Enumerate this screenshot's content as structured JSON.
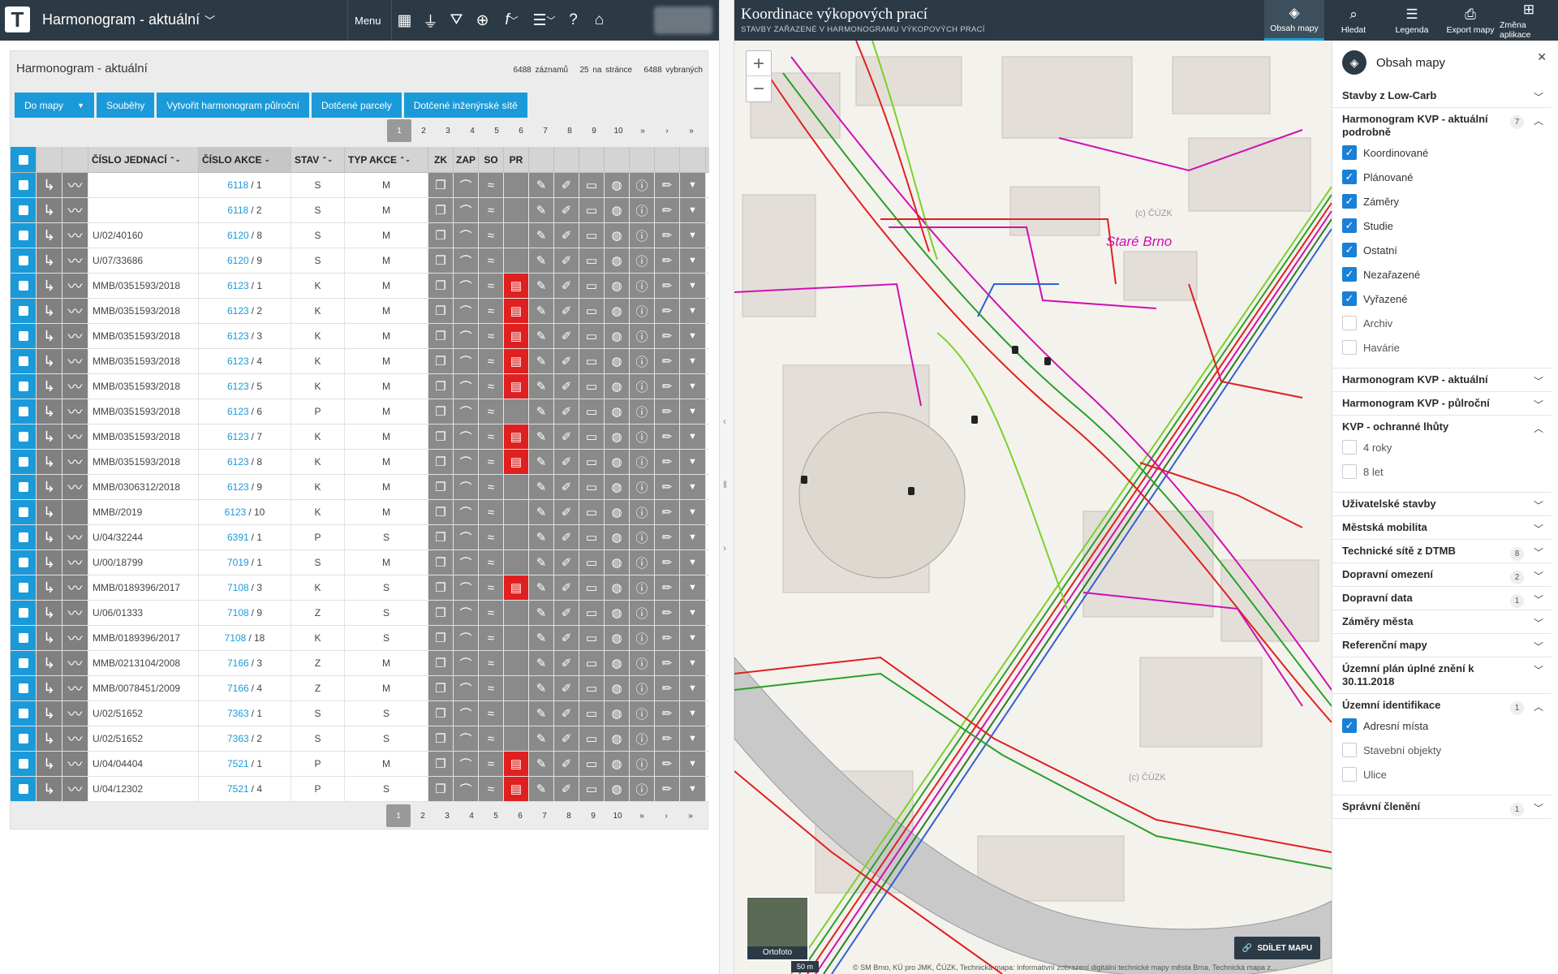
{
  "left": {
    "app_title": "Harmonogram - aktuální",
    "menu_label": "Menu",
    "panel_title": "Harmonogram - aktuální",
    "stats": {
      "records": "6488 záznamů",
      "per_page": "25 na stránce",
      "selected": "6488 vybraných"
    },
    "buttons": [
      "Do mapy",
      "Souběhy",
      "Vytvořit harmonogram půlroční",
      "Dotčené parcely",
      "Dotčené inženýrské sítě"
    ],
    "pagination": [
      "1",
      "2",
      "3",
      "4",
      "5",
      "6",
      "7",
      "8",
      "9",
      "10",
      "»",
      "›",
      "»"
    ],
    "columns": [
      "Číslo jednací",
      "Číslo akce",
      "Stav",
      "Typ akce",
      "ZK",
      "ZAP",
      "SO",
      "PR"
    ],
    "rows": [
      {
        "cj": "",
        "akce": "6118",
        "sub": "/ 1",
        "stav": "S",
        "typ": "M",
        "pr": false,
        "trend": true
      },
      {
        "cj": "",
        "akce": "6118",
        "sub": "/ 2",
        "stav": "S",
        "typ": "M",
        "pr": false,
        "trend": true
      },
      {
        "cj": "U/02/40160",
        "akce": "6120",
        "sub": "/ 8",
        "stav": "S",
        "typ": "M",
        "pr": false,
        "trend": true
      },
      {
        "cj": "U/07/33686",
        "akce": "6120",
        "sub": "/ 9",
        "stav": "S",
        "typ": "M",
        "pr": false,
        "trend": true
      },
      {
        "cj": "MMB/0351593/2018",
        "akce": "6123",
        "sub": "/ 1",
        "stav": "K",
        "typ": "M",
        "pr": true,
        "trend": true
      },
      {
        "cj": "MMB/0351593/2018",
        "akce": "6123",
        "sub": "/ 2",
        "stav": "K",
        "typ": "M",
        "pr": true,
        "trend": true
      },
      {
        "cj": "MMB/0351593/2018",
        "akce": "6123",
        "sub": "/ 3",
        "stav": "K",
        "typ": "M",
        "pr": true,
        "trend": true
      },
      {
        "cj": "MMB/0351593/2018",
        "akce": "6123",
        "sub": "/ 4",
        "stav": "K",
        "typ": "M",
        "pr": true,
        "trend": true
      },
      {
        "cj": "MMB/0351593/2018",
        "akce": "6123",
        "sub": "/ 5",
        "stav": "K",
        "typ": "M",
        "pr": true,
        "trend": true
      },
      {
        "cj": "MMB/0351593/2018",
        "akce": "6123",
        "sub": "/ 6",
        "stav": "P",
        "typ": "M",
        "pr": false,
        "trend": true
      },
      {
        "cj": "MMB/0351593/2018",
        "akce": "6123",
        "sub": "/ 7",
        "stav": "K",
        "typ": "M",
        "pr": true,
        "trend": true
      },
      {
        "cj": "MMB/0351593/2018",
        "akce": "6123",
        "sub": "/ 8",
        "stav": "K",
        "typ": "M",
        "pr": true,
        "trend": true
      },
      {
        "cj": "MMB/0306312/2018",
        "akce": "6123",
        "sub": "/ 9",
        "stav": "K",
        "typ": "M",
        "pr": false,
        "trend": true
      },
      {
        "cj": "MMB//2019",
        "akce": "6123",
        "sub": "/ 10",
        "stav": "K",
        "typ": "M",
        "pr": false,
        "trend": false
      },
      {
        "cj": "U/04/32244",
        "akce": "6391",
        "sub": "/ 1",
        "stav": "P",
        "typ": "S",
        "pr": false,
        "trend": true
      },
      {
        "cj": "U/00/18799",
        "akce": "7019",
        "sub": "/ 1",
        "stav": "S",
        "typ": "M",
        "pr": false,
        "trend": true
      },
      {
        "cj": "MMB/0189396/2017",
        "akce": "7108",
        "sub": "/ 3",
        "stav": "K",
        "typ": "S",
        "pr": true,
        "trend": true
      },
      {
        "cj": "U/06/01333",
        "akce": "7108",
        "sub": "/ 9",
        "stav": "Z",
        "typ": "S",
        "pr": false,
        "trend": true
      },
      {
        "cj": "MMB/0189396/2017",
        "akce": "7108",
        "sub": "/ 18",
        "stav": "K",
        "typ": "S",
        "pr": false,
        "trend": true
      },
      {
        "cj": "MMB/0213104/2008",
        "akce": "7166",
        "sub": "/ 3",
        "stav": "Z",
        "typ": "M",
        "pr": false,
        "trend": true
      },
      {
        "cj": "MMB/0078451/2009",
        "akce": "7166",
        "sub": "/ 4",
        "stav": "Z",
        "typ": "M",
        "pr": false,
        "trend": true
      },
      {
        "cj": "U/02/51652",
        "akce": "7363",
        "sub": "/ 1",
        "stav": "S",
        "typ": "S",
        "pr": false,
        "trend": true
      },
      {
        "cj": "U/02/51652",
        "akce": "7363",
        "sub": "/ 2",
        "stav": "S",
        "typ": "S",
        "pr": false,
        "trend": true
      },
      {
        "cj": "U/04/04404",
        "akce": "7521",
        "sub": "/ 1",
        "stav": "P",
        "typ": "M",
        "pr": true,
        "trend": true
      },
      {
        "cj": "U/04/12302",
        "akce": "7521",
        "sub": "/ 4",
        "stav": "P",
        "typ": "S",
        "pr": true,
        "trend": true
      }
    ]
  },
  "right": {
    "title": "Koordinace výkopových prací",
    "subtitle": "STAVBY ZAŘAZENÉ V HARMONOGRAMU VÝKOPOVÝCH PRACÍ",
    "tools": [
      {
        "label": "Obsah mapy",
        "icon": "layers-icon"
      },
      {
        "label": "Hledat",
        "icon": "search-icon"
      },
      {
        "label": "Legenda",
        "icon": "legend-icon"
      },
      {
        "label": "Export mapy",
        "icon": "print-icon"
      },
      {
        "label": "Změna aplikace",
        "icon": "apps-icon"
      }
    ],
    "map": {
      "place_label": "Staré Brno",
      "cuzk_label": "(c) ČÚZK",
      "ortofoto": "Ortofoto",
      "scale": "50 m",
      "share": "SDÍLET MAPU",
      "copyright": "© SM Brno, KÚ pro JMK, ČÚZK, Technická mapa: Informativní zobrazení digitální technické mapy města Brna. Technická mapa z..."
    },
    "panel": {
      "title": "Obsah mapy",
      "sections": [
        {
          "name": "Stavby z Low-Carb",
          "open": false
        },
        {
          "name": "Harmonogram KVP - aktuální podrobně",
          "count": "7",
          "open": true,
          "items": [
            {
              "label": "Koordinované",
              "checked": true
            },
            {
              "label": "Plánované",
              "checked": true
            },
            {
              "label": "Záměry",
              "checked": true
            },
            {
              "label": "Studie",
              "checked": true
            },
            {
              "label": "Ostatní",
              "checked": true
            },
            {
              "label": "Nezařazené",
              "checked": true
            },
            {
              "label": "Vyřazené",
              "checked": true
            },
            {
              "label": "Archiv",
              "checked": false
            },
            {
              "label": "Havárie",
              "checked": false
            }
          ]
        },
        {
          "name": "Harmonogram KVP - aktuální",
          "open": false
        },
        {
          "name": "Harmonogram KVP - půlroční",
          "open": false
        },
        {
          "name": "KVP - ochranné lhůty",
          "open": true,
          "items": [
            {
              "label": "4 roky",
              "checked": false
            },
            {
              "label": "8 let",
              "checked": false
            }
          ]
        },
        {
          "name": "Uživatelské stavby",
          "open": false
        },
        {
          "name": "Městská mobilita",
          "open": false
        },
        {
          "name": "Technické sítě z DTMB",
          "count": "8",
          "open": false
        },
        {
          "name": "Dopravní omezení",
          "count": "2",
          "open": false
        },
        {
          "name": "Dopravní data",
          "count": "1",
          "open": false
        },
        {
          "name": "Záměry města",
          "open": false
        },
        {
          "name": "Referenční mapy",
          "open": false
        },
        {
          "name": "Územní plán úplné znění k 30.11.2018",
          "open": false
        },
        {
          "name": "Územní identifikace",
          "count": "1",
          "open": true,
          "items": [
            {
              "label": "Adresní místa",
              "checked": true
            },
            {
              "label": "Stavební objekty",
              "checked": false
            },
            {
              "label": "Ulice",
              "checked": false
            }
          ]
        },
        {
          "name": "Správní členění",
          "count": "1",
          "open": false
        }
      ]
    }
  },
  "colors": {
    "topbar": "#2c3a45",
    "accent": "#1a9ad9",
    "red": "#e02020",
    "magenta": "#d10fb3"
  }
}
